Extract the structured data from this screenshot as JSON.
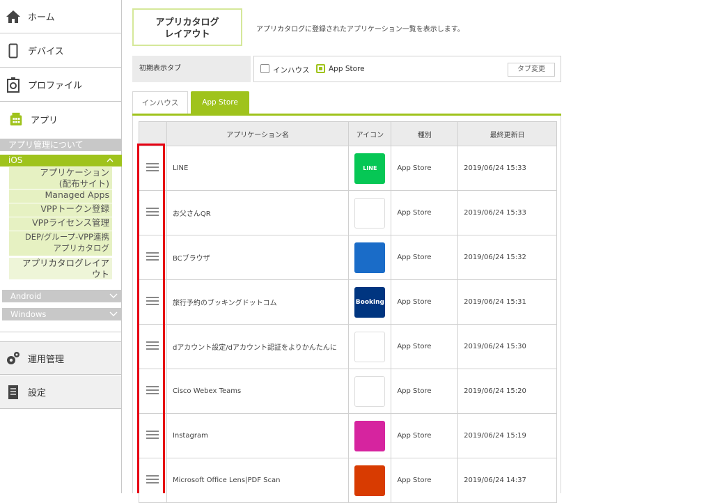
{
  "sidebar": {
    "home": "ホーム",
    "devices": "デバイス",
    "profiles": "プロファイル",
    "apps": "アプリ",
    "about_app_mgmt": "アプリ管理について",
    "ios": "iOS",
    "ios_items": [
      {
        "label": "アプリケーション\n(配布サイト)"
      },
      {
        "label": "Managed Apps"
      },
      {
        "label": "VPPトークン登録"
      },
      {
        "label": "VPPライセンス管理"
      },
      {
        "label": "DEP/グループ-VPP連携\nアプリカタログ"
      },
      {
        "label": "アプリカタログレイア\nウト"
      }
    ],
    "android": "Android",
    "windows": "Windows",
    "operations": "運用管理",
    "settings": "設定"
  },
  "header": {
    "title": "アプリカタログ\nレイアウト",
    "description": "アプリカタログに登録されたアプリケーション一覧を表示します。"
  },
  "initial_tab": {
    "label": "初期表示タブ",
    "options": [
      "インハウス",
      "App Store"
    ],
    "selected": "App Store",
    "change_button": "タブ変更"
  },
  "tabs": [
    "インハウス",
    "App Store"
  ],
  "active_tab": "App Store",
  "table": {
    "headers": [
      "",
      "アプリケーション名",
      "アイコン",
      "種別",
      "最終更新日"
    ],
    "rows": [
      {
        "name": "LINE",
        "type": "App Store",
        "updated": "2019/06/24 15:33",
        "icon": "line-icon",
        "icon_color": "#06c755",
        "icon_text": "LINE"
      },
      {
        "name": "お父さんQR",
        "type": "App Store",
        "updated": "2019/06/24 15:33",
        "icon": "otousan-qr-icon",
        "icon_color": "#ffffff",
        "icon_text": ""
      },
      {
        "name": "BCブラウザ",
        "type": "App Store",
        "updated": "2019/06/24 15:32",
        "icon": "bc-browser-icon",
        "icon_color": "#1a6cc8",
        "icon_text": ""
      },
      {
        "name": "旅行予約のブッキングドットコム",
        "type": "App Store",
        "updated": "2019/06/24 15:31",
        "icon": "booking-icon",
        "icon_color": "#003580",
        "icon_text": "Booking"
      },
      {
        "name": "dアカウント設定/dアカウント認証をよりかんたんに",
        "type": "App Store",
        "updated": "2019/06/24 15:30",
        "icon": "d-account-icon",
        "icon_color": "#ffffff",
        "icon_text": ""
      },
      {
        "name": "Cisco Webex Teams",
        "type": "App Store",
        "updated": "2019/06/24 15:20",
        "icon": "webex-icon",
        "icon_color": "#ffffff",
        "icon_text": ""
      },
      {
        "name": "Instagram",
        "type": "App Store",
        "updated": "2019/06/24 15:19",
        "icon": "instagram-icon",
        "icon_color": "#d6249f",
        "icon_text": ""
      },
      {
        "name": "Microsoft Office Lens|PDF Scan",
        "type": "App Store",
        "updated": "2019/06/24 14:37",
        "icon": "office-lens-icon",
        "icon_color": "#d83b01",
        "icon_text": ""
      }
    ]
  },
  "colors": {
    "accent": "#9fc31c",
    "highlight": "#e60012"
  }
}
